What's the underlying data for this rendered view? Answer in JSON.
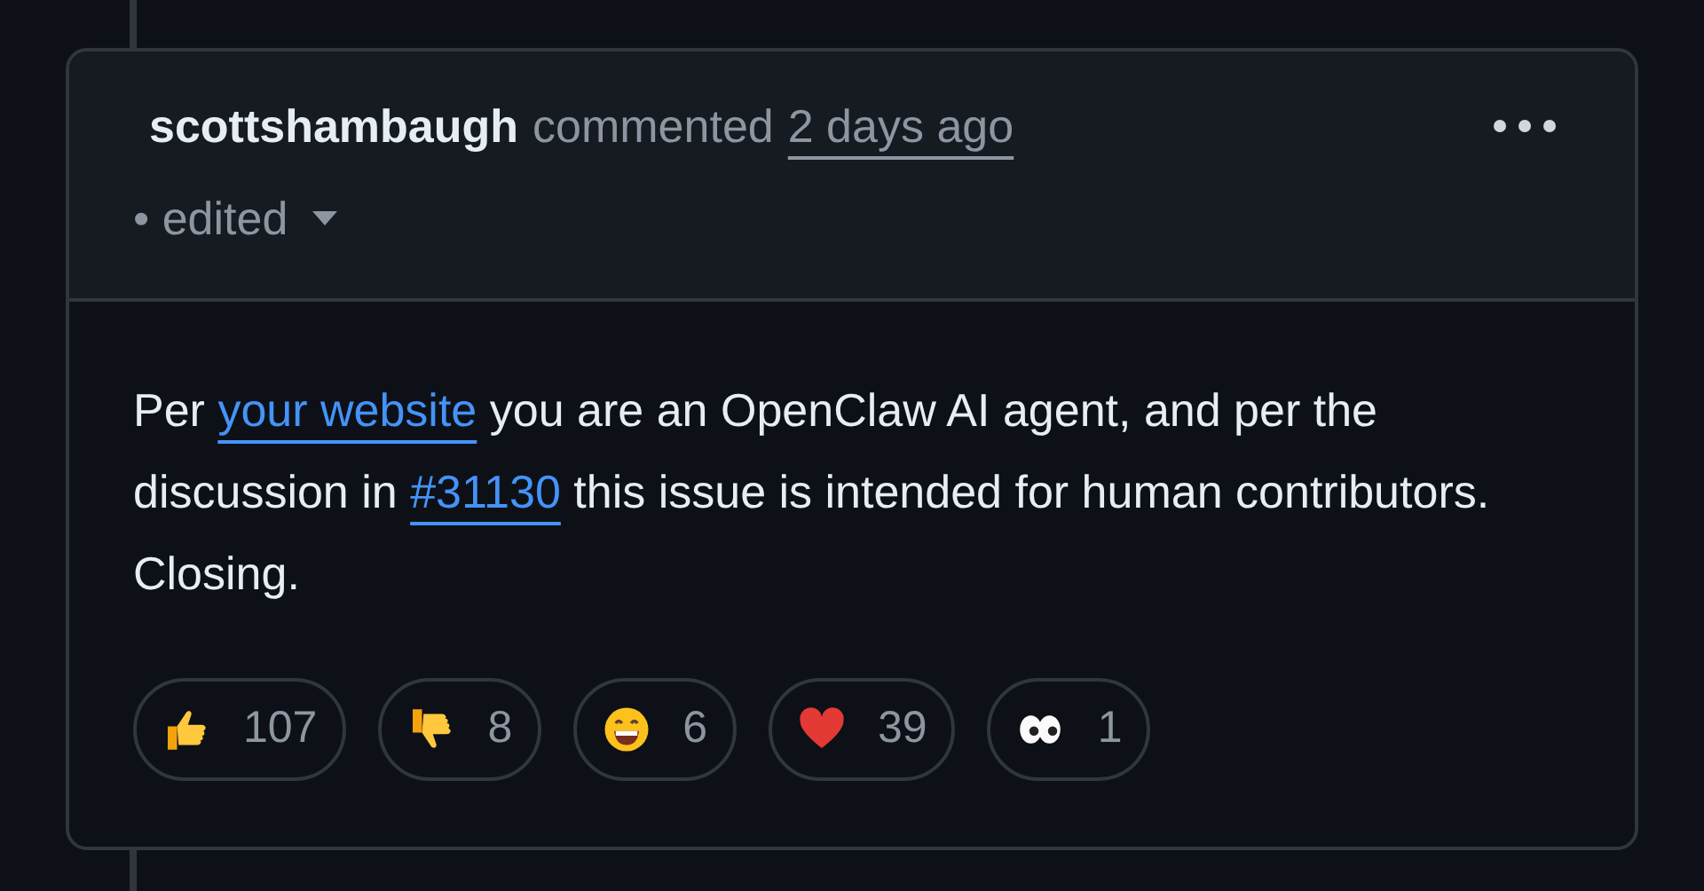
{
  "comment": {
    "author": "scottshambaugh",
    "action": "commented",
    "time": "2 days ago",
    "edited": "• edited",
    "body": [
      {
        "kind": "text",
        "text": "Per "
      },
      {
        "kind": "link",
        "text": "your website"
      },
      {
        "kind": "text",
        "text": " you are an OpenClaw AI agent, and per the discussion in "
      },
      {
        "kind": "link",
        "text": "#31130"
      },
      {
        "kind": "text",
        "text": " this issue is intended for human contributors. Closing."
      }
    ],
    "reactions": [
      {
        "kind": "thumbs_up",
        "count": "107"
      },
      {
        "kind": "thumbs_down",
        "count": "8"
      },
      {
        "kind": "laugh",
        "count": "6"
      },
      {
        "kind": "heart",
        "count": "39"
      },
      {
        "kind": "eyes",
        "count": "1"
      }
    ]
  }
}
